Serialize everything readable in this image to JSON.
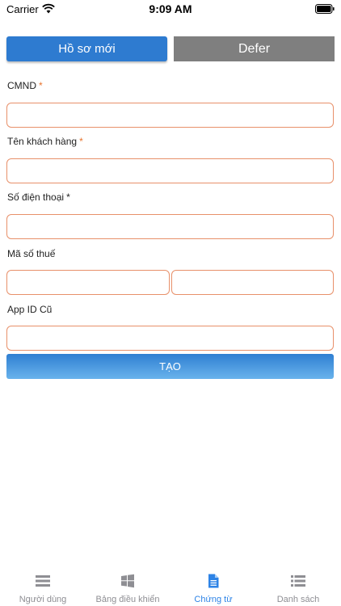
{
  "status_bar": {
    "carrier": "Carrier",
    "time": "9:09 AM"
  },
  "tabs": [
    {
      "label": "Hồ sơ mới",
      "active": true
    },
    {
      "label": "Defer",
      "active": false
    }
  ],
  "form": {
    "cmnd": {
      "label": "CMND",
      "required_mark": "*",
      "value": ""
    },
    "customer_name": {
      "label": "Tên khách hàng",
      "required_mark": "*",
      "value": ""
    },
    "phone": {
      "label": "Số điện thoại",
      "required_mark": "*",
      "value": ""
    },
    "tax_code": {
      "label": "Mã số thuế",
      "value_1": "",
      "value_2": ""
    },
    "old_app_id": {
      "label": "App ID Cũ",
      "value": ""
    },
    "submit_label": "TẠO"
  },
  "tab_bar": {
    "items": [
      {
        "label": "Người dùng",
        "icon": "menu-lines-icon"
      },
      {
        "label": "Bảng điều khiển",
        "icon": "windows-grid-icon"
      },
      {
        "label": "Chứng từ",
        "icon": "document-icon"
      },
      {
        "label": "Danh sách",
        "icon": "list-icon"
      }
    ],
    "active_index": 2
  },
  "colors": {
    "primary_blue": "#2e7bd0",
    "defer_gray": "#7f7f7f",
    "field_border": "#e8906a",
    "required_star": "#e8742e",
    "tab_active": "#2d83e6",
    "tab_inactive": "#8e8e93"
  }
}
